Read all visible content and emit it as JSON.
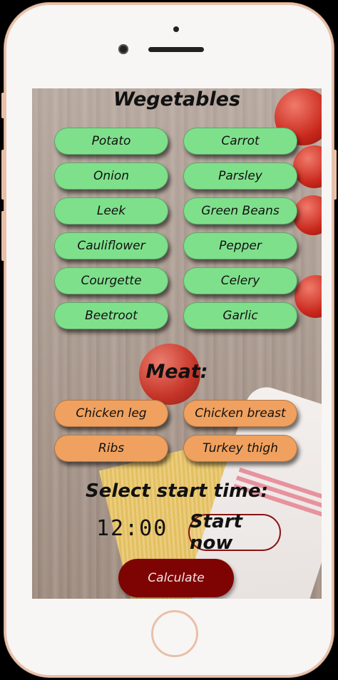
{
  "vegetables": {
    "title": "Wegetables",
    "items": [
      "Potato",
      "Carrot",
      "Onion",
      "Parsley",
      "Leek",
      "Green Beans",
      "Cauliflower",
      "Pepper",
      "Courgette",
      "Celery",
      "Beetroot",
      "Garlic"
    ]
  },
  "meat": {
    "title": "Meat:",
    "items": [
      "Chicken leg",
      "Chicken breast",
      "Ribs",
      "Turkey thigh"
    ]
  },
  "start_time": {
    "label": "Select start time:",
    "value": "12:00",
    "start_now_label": "Start now"
  },
  "calculate_label": "Calculate",
  "colors": {
    "vegetable_button": "#7fe08c",
    "meat_button": "#f0a15f",
    "calculate_button": "#7e0404"
  }
}
